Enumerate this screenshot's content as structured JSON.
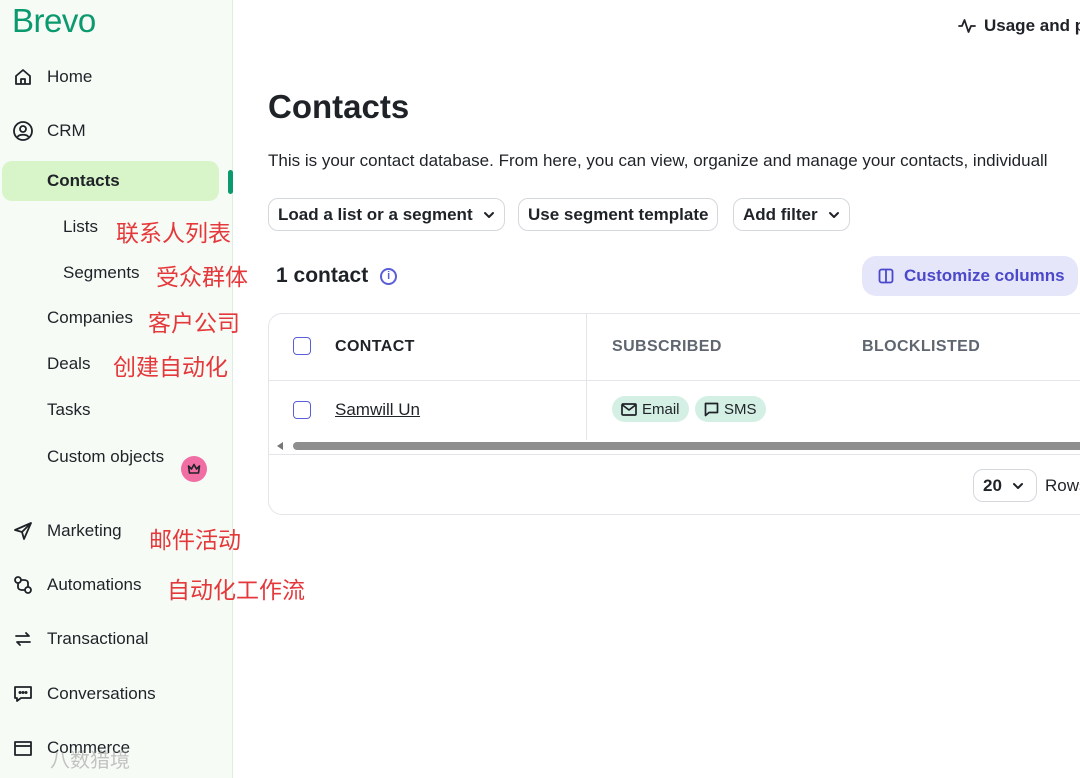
{
  "sidebar": {
    "logo": "Brevo",
    "items": [
      {
        "label": "Home",
        "icon": "home-icon"
      },
      {
        "label": "CRM",
        "icon": "user-circle-icon"
      },
      {
        "label": "Contacts"
      },
      {
        "label": "Lists"
      },
      {
        "label": "Segments"
      },
      {
        "label": "Companies"
      },
      {
        "label": "Deals"
      },
      {
        "label": "Tasks"
      },
      {
        "label": "Custom objects",
        "badge_icon": "crown-icon"
      },
      {
        "label": "Marketing",
        "icon": "send-icon"
      },
      {
        "label": "Automations",
        "icon": "automation-icon"
      },
      {
        "label": "Transactional",
        "icon": "arrows-swap-icon"
      },
      {
        "label": "Conversations",
        "icon": "chat-icon"
      },
      {
        "label": "Commerce",
        "icon": "store-icon"
      }
    ],
    "accent_color": "#0b996e",
    "active_bg": "#d7f5c8"
  },
  "annotations": {
    "lists": "联系人列表",
    "segments": "受众群体",
    "companies": "客户公司",
    "deals": "创建自动化",
    "marketing": "邮件活动",
    "automations": "自动化工作流"
  },
  "watermark": "八数猎境",
  "header": {
    "usage_label": "Usage and p",
    "usage_icon": "activity-icon"
  },
  "main": {
    "title": "Contacts",
    "description": "This is your contact database. From here, you can view, organize and manage your contacts, individuall",
    "filters": [
      {
        "label": "Load a list or a segment",
        "icon": "chevron-down-icon"
      },
      {
        "label": "Use segment template"
      },
      {
        "label": "Add filter",
        "icon": "chevron-down-icon"
      }
    ],
    "count_label": "1 contact",
    "customize_label": "Customize columns",
    "table": {
      "columns": [
        "CONTACT",
        "SUBSCRIBED",
        "BLOCKLISTED"
      ],
      "rows": [
        {
          "contact": "Samwill Un",
          "subscribed": [
            "Email",
            "SMS"
          ],
          "blocklisted": ""
        }
      ]
    },
    "pagination": {
      "rows_per_page": "20",
      "rows_label": "Rows"
    }
  }
}
